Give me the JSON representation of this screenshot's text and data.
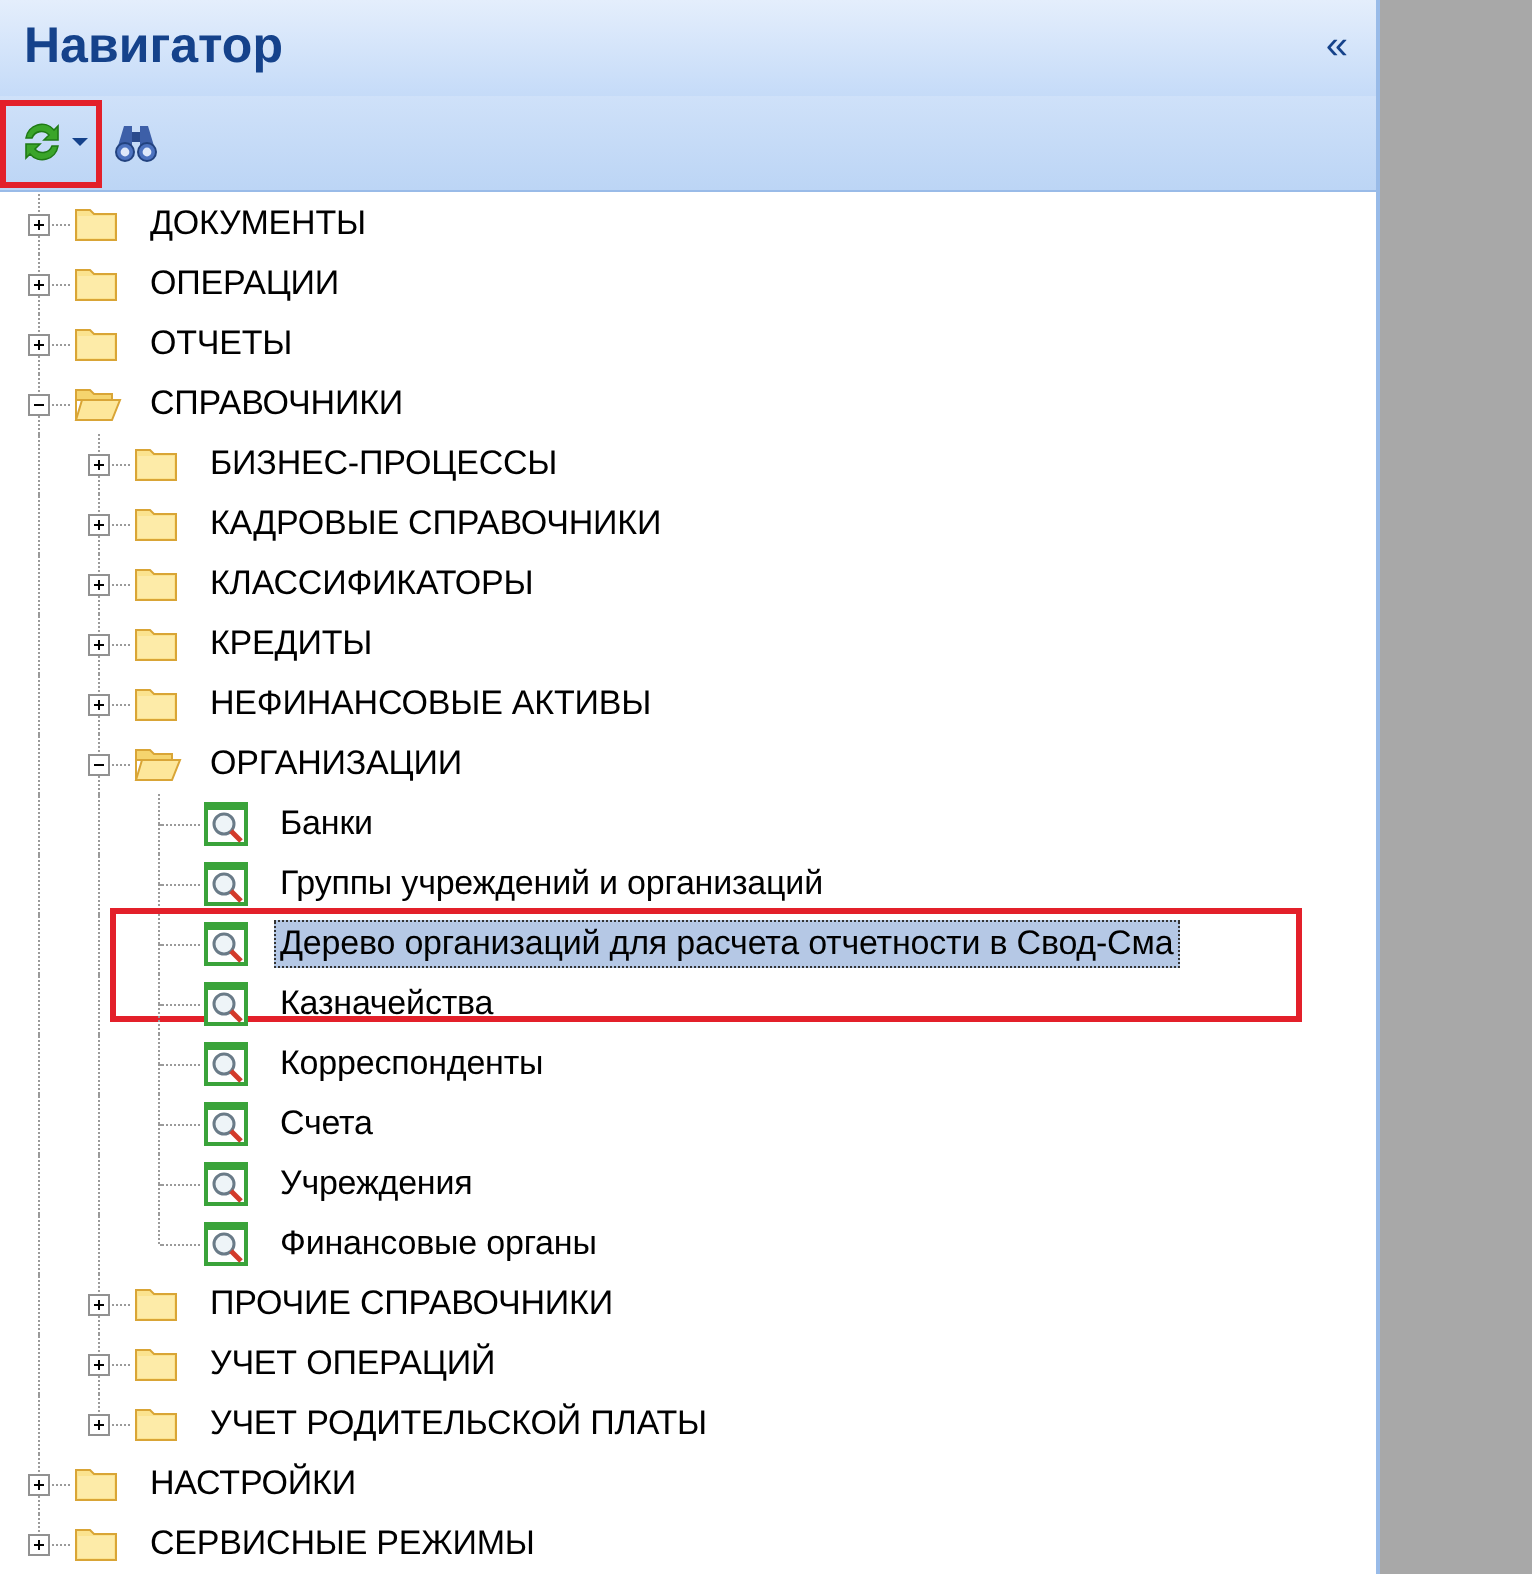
{
  "panel": {
    "title": "Навигатор",
    "collapse_button": "«"
  },
  "toolbar": [
    {
      "kind": "refresh",
      "has_dropdown": true,
      "annotated": true
    },
    {
      "kind": "find",
      "has_dropdown": false,
      "annotated": false
    }
  ],
  "tree": [
    {
      "label": "ДОКУМЕНТЫ",
      "kind": "folder",
      "expanded": false,
      "selected": false,
      "annotated": false
    },
    {
      "label": "ОПЕРАЦИИ",
      "kind": "folder",
      "expanded": false,
      "selected": false,
      "annotated": false
    },
    {
      "label": "ОТЧЕТЫ",
      "kind": "folder",
      "expanded": false,
      "selected": false,
      "annotated": false
    },
    {
      "label": "СПРАВОЧНИКИ",
      "kind": "folder",
      "expanded": true,
      "selected": false,
      "annotated": false,
      "children": [
        {
          "label": "БИЗНЕС-ПРОЦЕССЫ",
          "kind": "folder",
          "expanded": false,
          "selected": false,
          "annotated": false
        },
        {
          "label": "КАДРОВЫЕ СПРАВОЧНИКИ",
          "kind": "folder",
          "expanded": false,
          "selected": false,
          "annotated": false
        },
        {
          "label": "КЛАССИФИКАТОРЫ",
          "kind": "folder",
          "expanded": false,
          "selected": false,
          "annotated": false
        },
        {
          "label": "КРЕДИТЫ",
          "kind": "folder",
          "expanded": false,
          "selected": false,
          "annotated": false
        },
        {
          "label": "НЕФИНАНСОВЫЕ АКТИВЫ",
          "kind": "folder",
          "expanded": false,
          "selected": false,
          "annotated": false
        },
        {
          "label": "ОРГАНИЗАЦИИ",
          "kind": "folder",
          "expanded": true,
          "selected": false,
          "annotated": false,
          "children": [
            {
              "label": "Банки",
              "kind": "reference",
              "selected": false,
              "annotated": false
            },
            {
              "label": "Группы учреждений и организаций",
              "kind": "reference",
              "selected": false,
              "annotated": false
            },
            {
              "label": "Дерево организаций для расчета отчетности в Свод-Сма",
              "kind": "reference",
              "selected": true,
              "annotated": true
            },
            {
              "label": "Казначейства",
              "kind": "reference",
              "selected": false,
              "annotated": false
            },
            {
              "label": "Корреспонденты",
              "kind": "reference",
              "selected": false,
              "annotated": false
            },
            {
              "label": "Счета",
              "kind": "reference",
              "selected": false,
              "annotated": false
            },
            {
              "label": "Учреждения",
              "kind": "reference",
              "selected": false,
              "annotated": false
            },
            {
              "label": "Финансовые органы",
              "kind": "reference",
              "selected": false,
              "annotated": false
            }
          ]
        },
        {
          "label": "ПРОЧИЕ СПРАВОЧНИКИ",
          "kind": "folder",
          "expanded": false,
          "selected": false,
          "annotated": false
        },
        {
          "label": "УЧЕТ ОПЕРАЦИЙ",
          "kind": "folder",
          "expanded": false,
          "selected": false,
          "annotated": false
        },
        {
          "label": "УЧЕТ РОДИТЕЛЬСКОЙ ПЛАТЫ",
          "kind": "folder",
          "expanded": false,
          "selected": false,
          "annotated": false
        }
      ]
    },
    {
      "label": "НАСТРОЙКИ",
      "kind": "folder",
      "expanded": false,
      "selected": false,
      "annotated": false
    },
    {
      "label": "СЕРВИСНЫЕ РЕЖИМЫ",
      "kind": "folder",
      "expanded": false,
      "selected": false,
      "annotated": false
    }
  ]
}
